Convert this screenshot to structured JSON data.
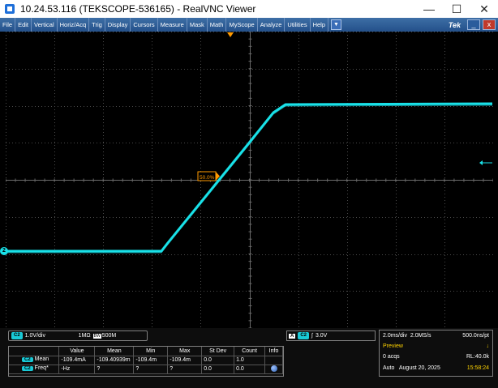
{
  "window": {
    "title": "10.24.53.116 (TEKSCOPE-536165) - RealVNC Viewer",
    "minimize_glyph": "—",
    "maximize_glyph": "☐",
    "close_glyph": "✕"
  },
  "menu": {
    "items": [
      "File",
      "Edit",
      "Vertical",
      "Horiz/Acq",
      "Trig",
      "Display",
      "Cursors",
      "Measure",
      "Mask",
      "Math",
      "MyScope",
      "Analyze",
      "Utilities",
      "Help"
    ],
    "dropdown_glyph": "▼",
    "brand": "Tek",
    "min_glyph": "_",
    "close_glyph": "x"
  },
  "scope": {
    "trace_color": "#19e1e8",
    "grid_color": "#4a4a4a",
    "trigger_marker_color": "#ff9a00",
    "ch_label": "2",
    "mid_label": "50.0%"
  },
  "channel": {
    "badge": "C2",
    "scale": "1.0V/div",
    "impedance": "1MΩ",
    "bw_label": "BW",
    "bw": "500M"
  },
  "trigger": {
    "a_label": "A",
    "badge": "C2",
    "slope_glyph": "∫",
    "level": "3.0V"
  },
  "horizontal": {
    "time_div": "2.0ms/div",
    "sample_rate": "2.0MS/s",
    "ns_pt": "500.0ns/pt",
    "mode": "Preview",
    "acqs": "0 acqs",
    "rl": "RL:40.0k",
    "auto": "Auto",
    "date": "August 20, 2025",
    "time": "15:58:24"
  },
  "measurements": {
    "headers": [
      "",
      "Value",
      "Mean",
      "Min",
      "Max",
      "St Dev",
      "Count",
      "Info"
    ],
    "rows": [
      {
        "badge": "C2",
        "name": "Mean",
        "value": "-109.4mA",
        "mean": "-109.40939m",
        "min": "-109.4m",
        "max": "-109.4m",
        "stdev": "0.0",
        "count": "1.0",
        "info": ""
      },
      {
        "badge": "C2",
        "name": "Freq*",
        "value": "-Hz",
        "mean": "?",
        "min": "?",
        "max": "?",
        "stdev": "0.0",
        "count": "0.0",
        "info": "globe-icon"
      }
    ]
  }
}
